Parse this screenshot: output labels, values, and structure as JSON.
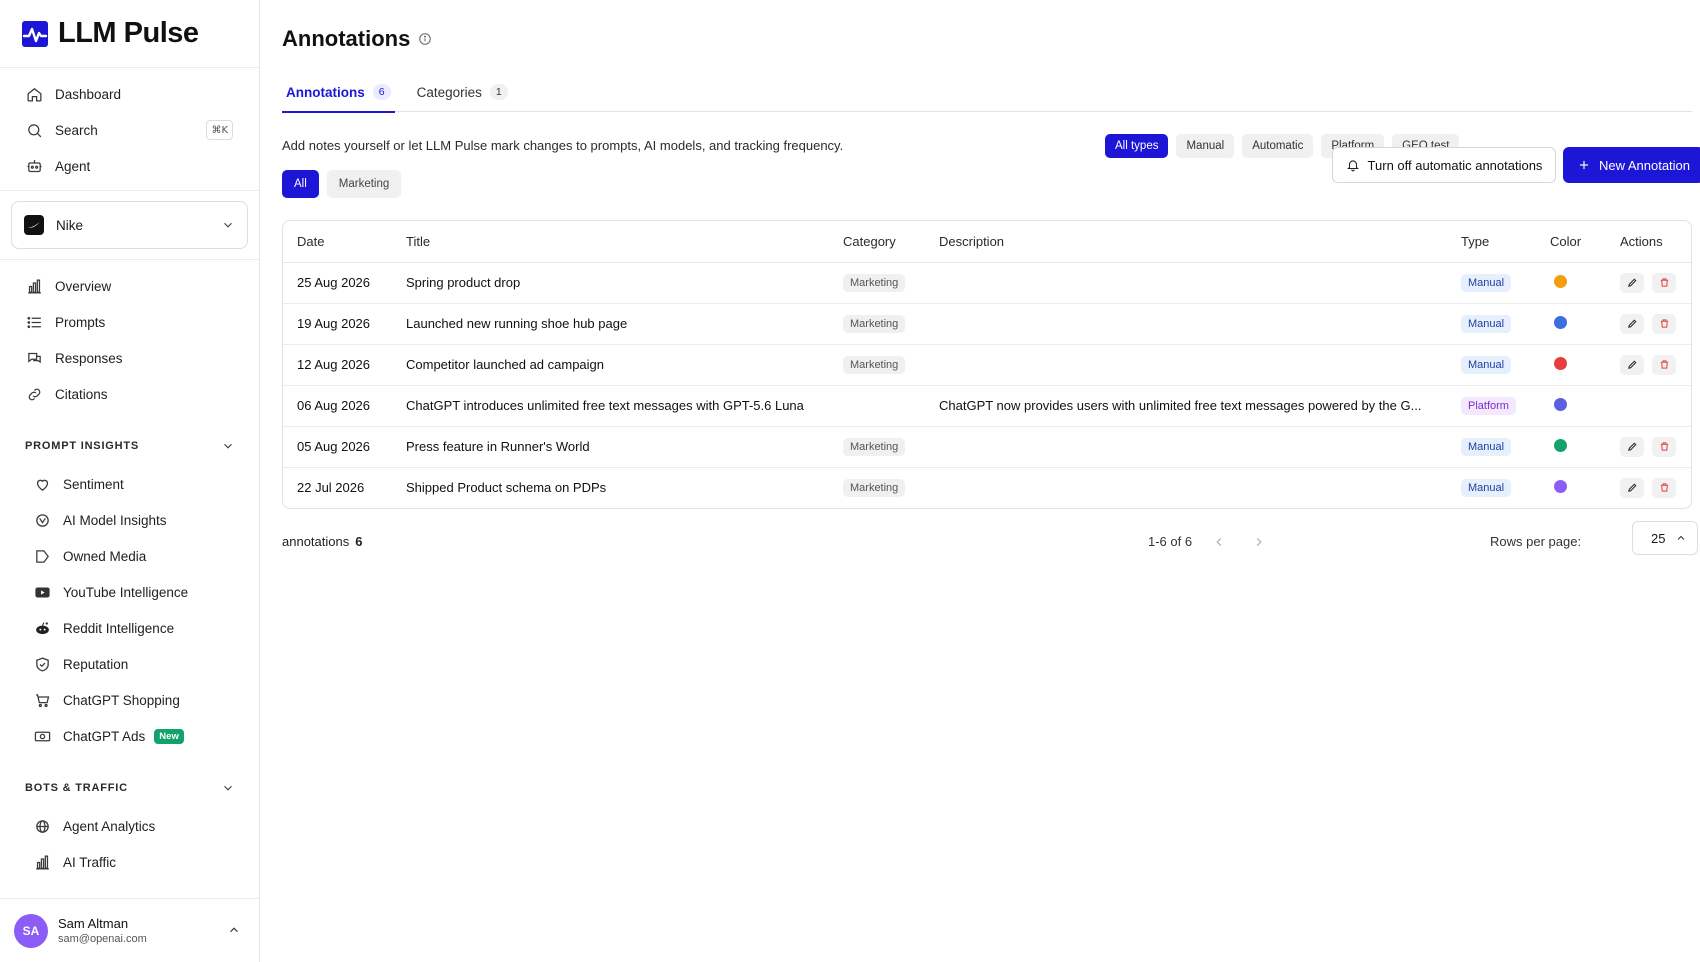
{
  "app": {
    "logo_text": "LLM Pulse"
  },
  "sidebar": {
    "top_items": [
      {
        "label": "Dashboard"
      },
      {
        "label": "Search",
        "shortcut": "⌘K"
      },
      {
        "label": "Agent"
      }
    ],
    "brand": {
      "name": "Nike"
    },
    "main_items": [
      {
        "label": "Overview"
      },
      {
        "label": "Prompts"
      },
      {
        "label": "Responses"
      },
      {
        "label": "Citations"
      }
    ],
    "sections": [
      {
        "title": "PROMPT INSIGHTS",
        "items": [
          {
            "label": "Sentiment"
          },
          {
            "label": "AI Model Insights"
          },
          {
            "label": "Owned Media"
          },
          {
            "label": "YouTube Intelligence"
          },
          {
            "label": "Reddit Intelligence"
          },
          {
            "label": "Reputation"
          },
          {
            "label": "ChatGPT Shopping"
          },
          {
            "label": "ChatGPT Ads",
            "badge": "New"
          }
        ]
      },
      {
        "title": "BOTS & TRAFFIC",
        "items": [
          {
            "label": "Agent Analytics"
          },
          {
            "label": "AI Traffic"
          }
        ]
      }
    ],
    "user": {
      "initials": "SA",
      "name": "Sam Altman",
      "email": "sam@openai.com"
    }
  },
  "page": {
    "title": "Annotations",
    "tabs": [
      {
        "label": "Annotations",
        "count": "6",
        "active": true
      },
      {
        "label": "Categories",
        "count": "1",
        "active": false
      }
    ],
    "description": "Add notes yourself or let LLM Pulse mark changes to prompts, AI models, and tracking frequency.",
    "type_filters": [
      "All types",
      "Manual",
      "Automatic",
      "Platform",
      "GEO test"
    ],
    "category_filters": [
      "All",
      "Marketing"
    ],
    "buttons": {
      "turn_off": "Turn off automatic annotations",
      "new": "New Annotation"
    },
    "table": {
      "headers": [
        "Date",
        "Title",
        "Category",
        "Description",
        "Type",
        "Color",
        "Actions"
      ],
      "rows": [
        {
          "date": "25 Aug 2026",
          "title": "Spring product drop",
          "category": "Marketing",
          "description": "",
          "type": "Manual",
          "color": "#f59e0b",
          "actions": true
        },
        {
          "date": "19 Aug 2026",
          "title": "Launched new running shoe hub page",
          "category": "Marketing",
          "description": "",
          "type": "Manual",
          "color": "#3b6fe0",
          "actions": true
        },
        {
          "date": "12 Aug 2026",
          "title": "Competitor launched ad campaign",
          "category": "Marketing",
          "description": "",
          "type": "Manual",
          "color": "#e53e3e",
          "actions": true
        },
        {
          "date": "06 Aug 2026",
          "title": "ChatGPT introduces unlimited free text messages with GPT-5.6 Luna",
          "category": "",
          "description": "ChatGPT now provides users with unlimited free text messages powered by the G...",
          "type": "Platform",
          "color": "#5b5fe0",
          "actions": false
        },
        {
          "date": "05 Aug 2026",
          "title": "Press feature in Runner's World",
          "category": "Marketing",
          "description": "",
          "type": "Manual",
          "color": "#12a36b",
          "actions": true
        },
        {
          "date": "22 Jul 2026",
          "title": "Shipped Product schema on PDPs",
          "category": "Marketing",
          "description": "",
          "type": "Manual",
          "color": "#8b5cf6",
          "actions": true
        }
      ]
    },
    "footer": {
      "count_label": "annotations",
      "count": "6",
      "range": "1-6 of 6",
      "rows_label": "Rows per page:",
      "rows_value": "25"
    }
  }
}
